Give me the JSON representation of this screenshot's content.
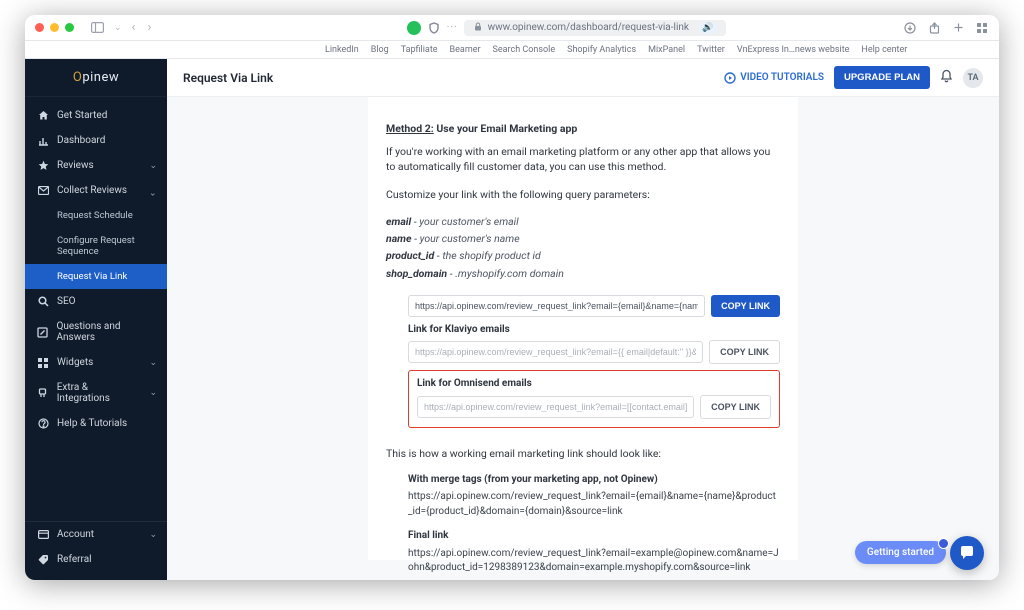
{
  "browser": {
    "url_display": "www.opinew.com/dashboard/request-via-link",
    "bookmarks": [
      "LinkedIn",
      "Blog",
      "Tapfiliate",
      "Beamer",
      "Search Console",
      "Shopify Analytics",
      "MixPanel",
      "Twitter",
      "VnExpress In…news website",
      "Help center"
    ]
  },
  "brand": {
    "name_pre": "O",
    "name_mid": "pinew"
  },
  "sidebar": {
    "items": [
      {
        "label": "Get Started",
        "icon": "home"
      },
      {
        "label": "Dashboard",
        "icon": "chart"
      },
      {
        "label": "Reviews",
        "icon": "star",
        "chevron": true
      },
      {
        "label": "Collect Reviews",
        "icon": "envelope",
        "chevron": true,
        "open": true
      },
      {
        "label": "SEO",
        "icon": "search"
      },
      {
        "label": "Questions and Answers",
        "icon": "edit"
      },
      {
        "label": "Widgets",
        "icon": "grid",
        "chevron": true
      },
      {
        "label": "Extra & Integrations",
        "icon": "plug",
        "chevron": true
      },
      {
        "label": "Help & Tutorials",
        "icon": "help"
      }
    ],
    "sub_items": [
      "Request Schedule",
      "Configure Request Sequence",
      "Request Via Link"
    ],
    "bottom": [
      {
        "label": "Account",
        "icon": "card",
        "chevron": true
      },
      {
        "label": "Referral",
        "icon": "tag"
      }
    ]
  },
  "topbar": {
    "title": "Request Via Link",
    "video_link": "VIDEO TUTORIALS",
    "upgrade": "UPGRADE PLAN",
    "avatar": "TA"
  },
  "content": {
    "method_label": "Method 2:",
    "method_title": "Use your Email Marketing app",
    "desc": "If you're working with an email marketing platform or any other app that allows you to automatically fill customer data, you can use this method.",
    "customize": "Customize your link with the following query parameters:",
    "params": [
      {
        "k": "email",
        "v": "your customer's email"
      },
      {
        "k": "name",
        "v": "your customer's name"
      },
      {
        "k": "product_id",
        "v": "the shopify product id"
      },
      {
        "k": "shop_domain",
        "v": ".myshopify.com domain"
      }
    ],
    "link_generic": "https://api.opinew.com/review_request_link?email={email}&name={name}&product_id",
    "klaviyo_label": "Link for Klaviyo emails",
    "link_klaviyo": "https://api.opinew.com/review_request_link?email={{ email|default:'' }}&name={{ first_n",
    "omnisend_label": "Link for Omnisend emails",
    "link_omnisend": "https://api.opinew.com/review_request_link?email=[[contact.email]]&name=[[contact.f",
    "copy": "COPY LINK",
    "explain": "This is how a working email marketing link should look like:",
    "merge_h": "With merge tags (from your marketing app, not Opinew)",
    "merge_url": "https://api.opinew.com/review_request_link?email={email}&name={name}&product_id={product_id}&domain={domain}&source=link",
    "final_h": "Final link",
    "final_url": "https://api.opinew.com/review_request_link?email=example@opinew.com&name=John&product_id=1298389123&domain=example.myshopify.com&source=link"
  },
  "floaters": {
    "getting_started": "Getting started"
  }
}
